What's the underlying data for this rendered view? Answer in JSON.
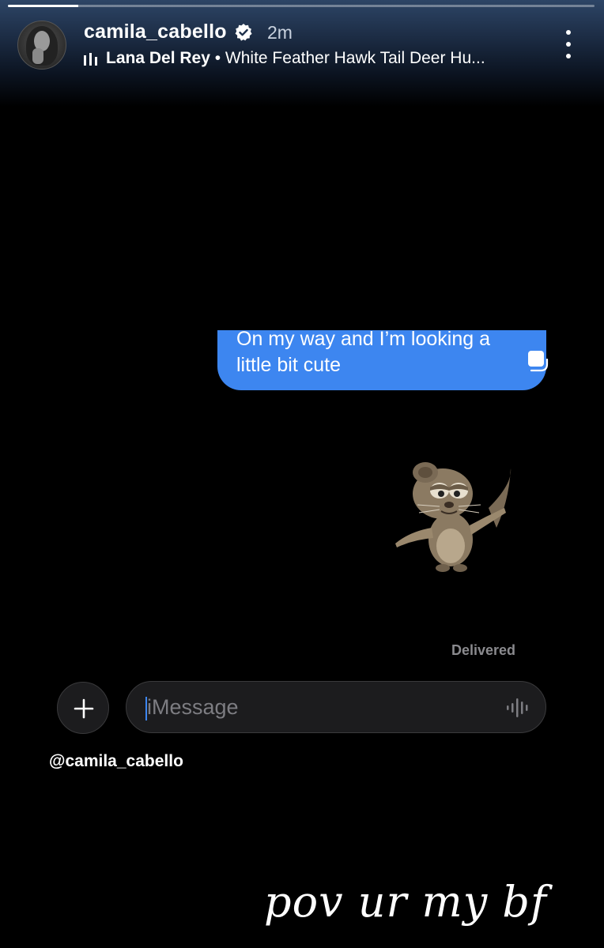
{
  "story": {
    "progress_fraction": 0.12,
    "username": "camila_cabello",
    "time_ago": "2m",
    "music": {
      "artist": "Lana Del Rey",
      "separator": " • ",
      "track": "White Feather Hawk Tail Deer Hu..."
    },
    "mention": "@camila_cabello",
    "caption": "pov ur my bf"
  },
  "chat": {
    "message": "On my way and I’m looking a little bit cute",
    "status": "Delivered",
    "input_placeholder": "iMessage"
  },
  "icons": {
    "verified": "verified-badge-icon",
    "music": "music-bars-icon",
    "more": "more-vertical-icon",
    "plus": "plus-icon",
    "voice": "voice-waveform-icon",
    "square": "square-icon"
  },
  "colors": {
    "bubble": "#3d86f0",
    "background": "#000000",
    "header_gradient": "#2d4566"
  }
}
